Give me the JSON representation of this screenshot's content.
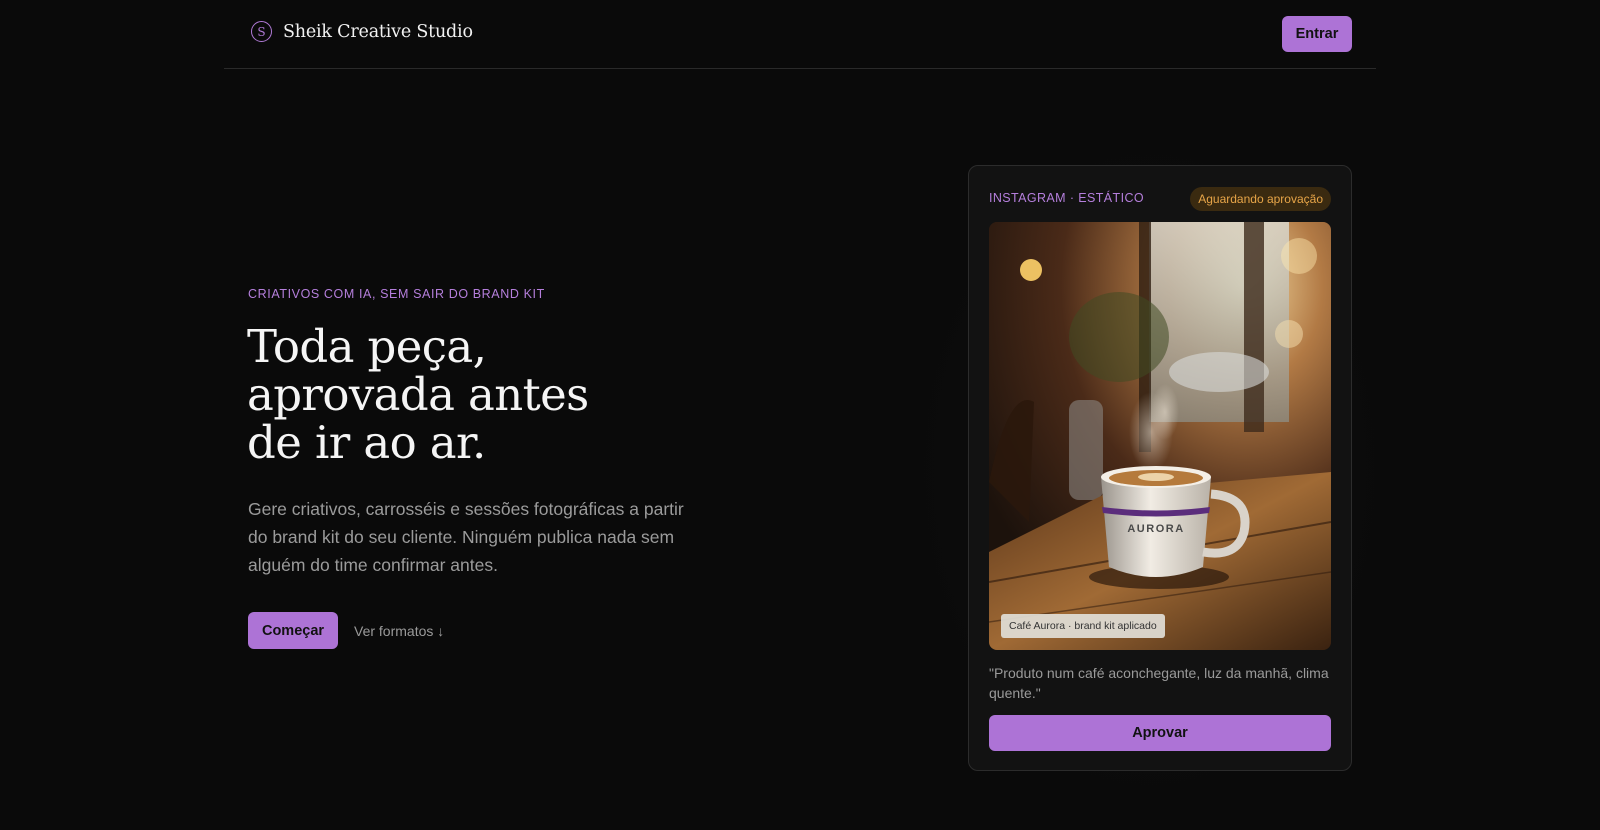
{
  "header": {
    "logo_letter": "S",
    "brand_name": "Sheik Creative Studio",
    "login_label": "Entrar"
  },
  "hero": {
    "eyebrow": "CRIATIVOS COM IA, SEM SAIR DO BRAND KIT",
    "headline_lines": [
      "Toda peça,",
      "aprovada antes",
      "de ir ao ar."
    ],
    "subtitle": "Gere criativos, carrosséis e sessões fotográficas a partir do brand kit do seu cliente. Ninguém publica nada sem alguém do time confirmar antes.",
    "cta_primary": "Começar",
    "cta_secondary": "Ver formatos ↓"
  },
  "card": {
    "meta": "INSTAGRAM · ESTÁTICO",
    "status_badge": "Aguardando aprovação",
    "mug_text": "AURORA",
    "photo_caption": "Café Aurora · brand kit aplicado",
    "prompt": "\"Produto num café aconchegante, luz da manhã, clima quente.\"",
    "approve_label": "Aprovar"
  },
  "colors": {
    "background": "#0a0a0a",
    "accent": "#ad73d6",
    "accent_text": "#b57fdc",
    "badge_text": "#e7a548",
    "badge_bg": "#3a2a10"
  }
}
